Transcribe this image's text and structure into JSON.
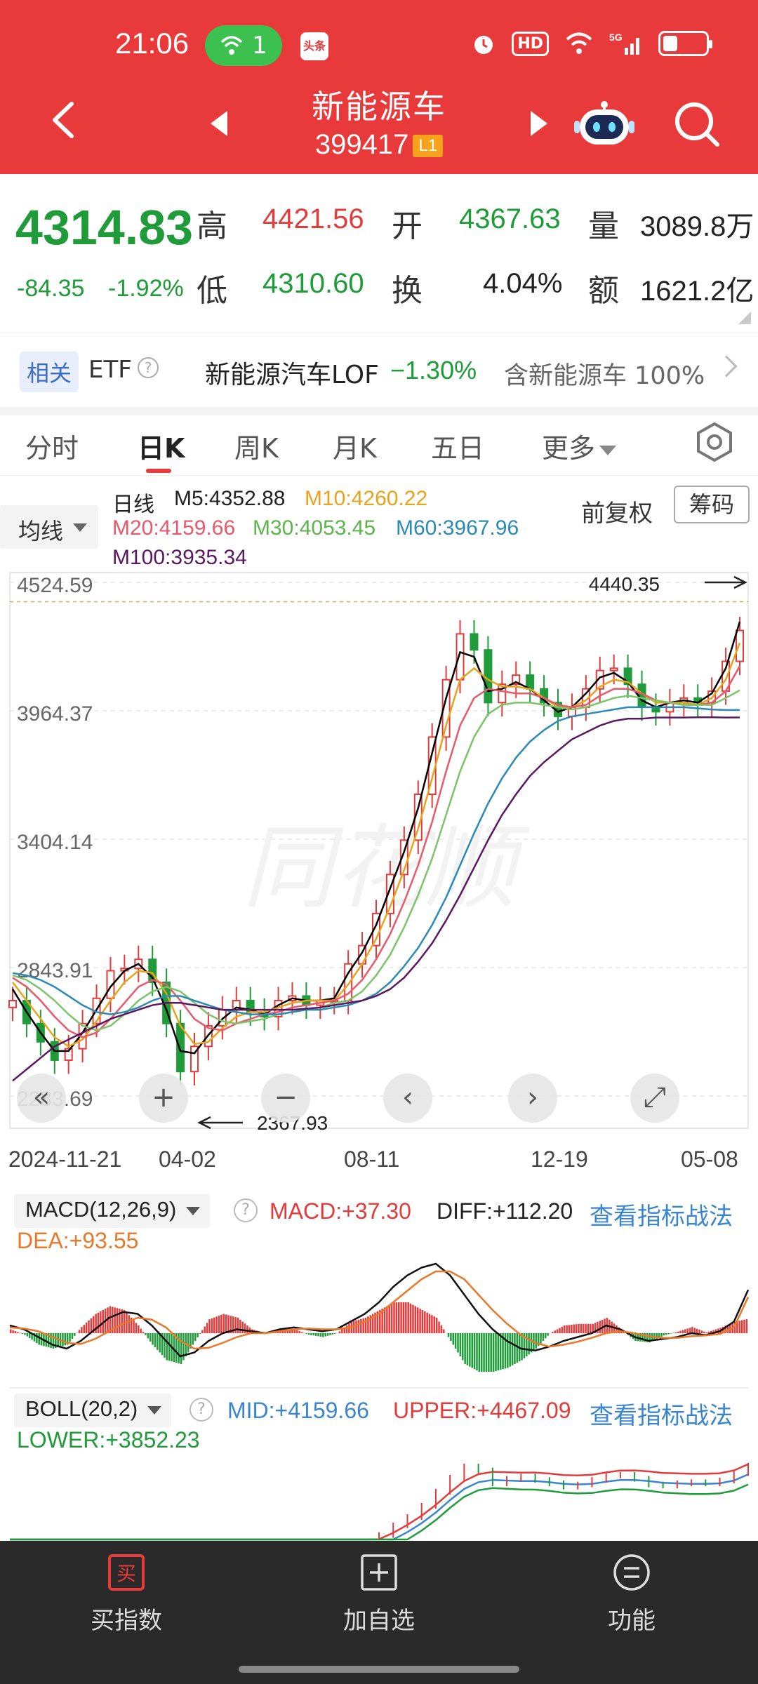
{
  "status_bar": {
    "time": "21:06",
    "hotspot_count": "1",
    "app_badge": "头条",
    "hd": "HD",
    "signal": "5G"
  },
  "header": {
    "title": "新能源车",
    "code": "399417",
    "level": "L1"
  },
  "quote": {
    "price": "4314.83",
    "change": "-84.35",
    "change_pct": "-1.92%",
    "high_label": "高",
    "high": "4421.56",
    "open_label": "开",
    "open": "4367.63",
    "volume_label": "量",
    "volume": "3089.8万",
    "low_label": "低",
    "low": "4310.60",
    "turnover_label": "换",
    "turnover": "4.04%",
    "amount_label": "额",
    "amount": "1621.2亿"
  },
  "etf": {
    "badge": "相关",
    "label": "ETF",
    "help": "?",
    "name": "新能源汽车LOF",
    "change": "−1.30%",
    "contain": "含新能源车 100%"
  },
  "tabs": [
    "分时",
    "日K",
    "周K",
    "月K",
    "五日",
    "更多"
  ],
  "ma_legend": {
    "button": "均线",
    "period": "日线",
    "m5": "M5:4352.88",
    "m10": "M10:4260.22",
    "m20": "M20:4159.66",
    "m30": "M30:4053.45",
    "m60": "M60:3967.96",
    "m100": "M100:3935.34",
    "adjust": "前复权",
    "chips": "筹码"
  },
  "chart_data": {
    "type": "line",
    "y_ticks": [
      "4524.59",
      "3964.37",
      "3404.14",
      "2843.91",
      "2283.69"
    ],
    "x_ticks": [
      "2024-11-21",
      "04-02",
      "08-11",
      "12-19",
      "05-08"
    ],
    "max_marker": "4440.35",
    "min_marker": "2367.93",
    "ylim": [
      2283.69,
      4524.59
    ],
    "series": [
      {
        "name": "日线",
        "values": [
          2700,
          2600,
          2520,
          2440,
          2490,
          2600,
          2710,
          2830,
          2840,
          2880,
          2780,
          2600,
          2390,
          2500,
          2590,
          2660,
          2700,
          2650,
          2630,
          2700,
          2720,
          2680,
          2700,
          2700,
          2860,
          2940,
          3080,
          3250,
          3400,
          3600,
          3850,
          4100,
          4300,
          4230,
          4000,
          4080,
          4120,
          4060,
          4000,
          3940,
          3980,
          4060,
          4140,
          4150,
          4080,
          3980,
          3960,
          4000,
          4020,
          4000,
          4050,
          4180,
          4314.83
        ]
      },
      {
        "name": "M5",
        "values": [
          2750,
          2650,
          2560,
          2480,
          2480,
          2560,
          2660,
          2760,
          2830,
          2860,
          2800,
          2660,
          2480,
          2470,
          2550,
          2620,
          2670,
          2660,
          2640,
          2680,
          2710,
          2700,
          2700,
          2710,
          2820,
          2910,
          3030,
          3190,
          3350,
          3540,
          3780,
          4020,
          4220,
          4200,
          4050,
          4060,
          4090,
          4060,
          4010,
          3960,
          3980,
          4040,
          4110,
          4130,
          4090,
          4010,
          3980,
          4000,
          4010,
          4000,
          4040,
          4150,
          4352.88
        ]
      },
      {
        "name": "M10",
        "values": [
          2780,
          2700,
          2620,
          2540,
          2500,
          2530,
          2610,
          2700,
          2780,
          2830,
          2820,
          2730,
          2590,
          2510,
          2520,
          2580,
          2630,
          2650,
          2650,
          2670,
          2690,
          2700,
          2700,
          2700,
          2770,
          2860,
          2970,
          3110,
          3270,
          3450,
          3670,
          3900,
          4100,
          4150,
          4100,
          4070,
          4070,
          4060,
          4020,
          3980,
          3980,
          4010,
          4070,
          4100,
          4090,
          4040,
          4000,
          4000,
          4000,
          3990,
          4020,
          4100,
          4260.22
        ]
      },
      {
        "name": "M20",
        "values": [
          2800,
          2760,
          2700,
          2630,
          2570,
          2540,
          2560,
          2620,
          2690,
          2760,
          2790,
          2770,
          2700,
          2620,
          2580,
          2570,
          2600,
          2620,
          2640,
          2650,
          2670,
          2680,
          2690,
          2700,
          2730,
          2790,
          2880,
          2990,
          3130,
          3290,
          3480,
          3700,
          3900,
          4020,
          4060,
          4050,
          4040,
          4040,
          4020,
          3990,
          3980,
          3990,
          4030,
          4060,
          4060,
          4040,
          4010,
          4000,
          3990,
          3990,
          4000,
          4050,
          4159.66
        ]
      },
      {
        "name": "M30",
        "values": [
          2810,
          2790,
          2750,
          2700,
          2640,
          2590,
          2570,
          2590,
          2640,
          2700,
          2740,
          2760,
          2740,
          2690,
          2640,
          2610,
          2600,
          2610,
          2620,
          2640,
          2650,
          2660,
          2670,
          2690,
          2700,
          2740,
          2810,
          2900,
          3020,
          3160,
          3320,
          3510,
          3700,
          3850,
          3950,
          3990,
          4000,
          4000,
          3990,
          3980,
          3970,
          3980,
          4000,
          4020,
          4030,
          4020,
          4010,
          4000,
          3990,
          3990,
          3990,
          4020,
          4053.45
        ]
      },
      {
        "name": "M60",
        "values": [
          2820,
          2810,
          2790,
          2760,
          2720,
          2680,
          2650,
          2640,
          2650,
          2670,
          2700,
          2720,
          2720,
          2700,
          2680,
          2660,
          2650,
          2640,
          2640,
          2640,
          2650,
          2660,
          2660,
          2670,
          2680,
          2700,
          2730,
          2780,
          2850,
          2930,
          3030,
          3150,
          3290,
          3430,
          3560,
          3670,
          3760,
          3830,
          3880,
          3920,
          3940,
          3950,
          3960,
          3970,
          3980,
          3980,
          3980,
          3980,
          3980,
          3975,
          3970,
          3968,
          3967.96
        ]
      },
      {
        "name": "M100",
        "values": [
          2350,
          2400,
          2450,
          2500,
          2530,
          2560,
          2590,
          2620,
          2640,
          2660,
          2680,
          2690,
          2690,
          2680,
          2670,
          2660,
          2660,
          2660,
          2660,
          2660,
          2660,
          2665,
          2670,
          2680,
          2690,
          2700,
          2720,
          2750,
          2800,
          2870,
          2950,
          3050,
          3160,
          3280,
          3400,
          3510,
          3600,
          3680,
          3740,
          3790,
          3840,
          3870,
          3900,
          3920,
          3930,
          3930,
          3935,
          3935,
          3935,
          3936,
          3936,
          3935,
          3935.34
        ]
      }
    ]
  },
  "chart_colors": {
    "k": "#000000",
    "m5": "#000000",
    "m10": "#e8a21b",
    "m20": "#e85a6a",
    "m30": "#7cc46a",
    "m60": "#2a8ab4",
    "m100": "#5a1860",
    "up": "#e33b3b",
    "down": "#1f9b3a"
  },
  "chart_controls": [
    "«",
    "+",
    "−",
    "‹",
    "›",
    "⤢"
  ],
  "macd": {
    "name": "MACD(12,26,9)",
    "macd": "MACD:+37.30",
    "diff": "DIFF:+112.20",
    "dea": "DEA:+93.55",
    "link": "查看指标战法",
    "dif_values": [
      20,
      10,
      -10,
      -30,
      -40,
      -20,
      10,
      40,
      55,
      50,
      20,
      -20,
      -60,
      -50,
      -20,
      0,
      10,
      5,
      0,
      10,
      15,
      10,
      5,
      10,
      30,
      50,
      80,
      120,
      150,
      170,
      180,
      150,
      100,
      50,
      10,
      -20,
      -40,
      -45,
      -35,
      -20,
      -10,
      0,
      20,
      10,
      -10,
      -20,
      -15,
      -10,
      0,
      -5,
      5,
      30,
      112.2
    ],
    "dea_values": [
      15,
      12,
      5,
      -10,
      -25,
      -28,
      -15,
      5,
      25,
      40,
      35,
      15,
      -20,
      -40,
      -38,
      -25,
      -10,
      0,
      0,
      5,
      10,
      12,
      10,
      10,
      15,
      30,
      50,
      80,
      110,
      140,
      160,
      160,
      140,
      100,
      60,
      25,
      -5,
      -25,
      -35,
      -30,
      -22,
      -12,
      0,
      5,
      0,
      -8,
      -12,
      -12,
      -8,
      -6,
      -2,
      15,
      93.55
    ]
  },
  "boll": {
    "name": "BOLL(20,2)",
    "mid": "MID:+4159.66",
    "upper": "UPPER:+4467.09",
    "lower": "LOWER:+3852.23",
    "link": "查看指标战法"
  },
  "bottom_nav": [
    {
      "label": "买指数",
      "icon": "买"
    },
    {
      "label": "加自选",
      "icon": "+"
    },
    {
      "label": "功能",
      "icon": "≡"
    }
  ]
}
